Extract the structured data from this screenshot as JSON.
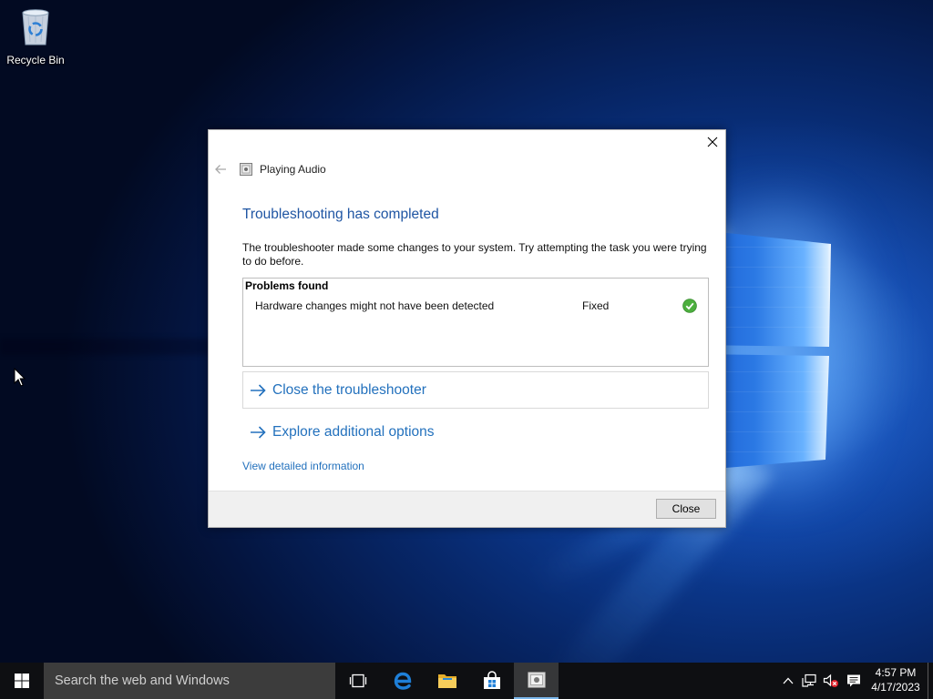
{
  "desktop": {
    "recycle_bin": {
      "label": "Recycle Bin",
      "icon": "recycle-bin-icon"
    },
    "cursor_icon": "mouse-pointer-icon"
  },
  "dialog": {
    "window_title": "Playing Audio",
    "title_icon": "troubleshooter-icon",
    "back_icon": "back-arrow-icon",
    "close_icon": "close-icon",
    "heading": "Troubleshooting has completed",
    "description": "The troubleshooter made some changes to your system. Try attempting the task you were trying to do before.",
    "problems": {
      "header": "Problems found",
      "items": [
        {
          "description": "Hardware changes might not have been detected",
          "status": "Fixed",
          "status_icon": "check-circle-icon"
        }
      ]
    },
    "actions": [
      {
        "label": "Close the troubleshooter",
        "icon": "arrow-right-icon"
      },
      {
        "label": "Explore additional options",
        "icon": "arrow-right-icon"
      }
    ],
    "details_link": "View detailed information",
    "close_button": "Close"
  },
  "taskbar": {
    "start_icon": "windows-logo-icon",
    "search": {
      "placeholder": "Search the web and Windows"
    },
    "apps": [
      {
        "icon": "task-view-icon",
        "active": false
      },
      {
        "icon": "edge-icon",
        "active": false
      },
      {
        "icon": "file-explorer-icon",
        "active": false
      },
      {
        "icon": "store-icon",
        "active": false
      },
      {
        "icon": "troubleshooter-icon",
        "active": true
      }
    ],
    "tray": {
      "icons": [
        "chevron-up-icon",
        "network-icon",
        "volume-muted-icon",
        "action-center-icon"
      ],
      "time": "4:57 PM",
      "date": "4/17/2023"
    }
  },
  "colors": {
    "accent": "#2371bd",
    "heading": "#1f55a3",
    "success": "#4caf3e",
    "taskbar": "#0e0f12",
    "active_indicator": "#7cb8ec",
    "desktop_dark": "#020a22",
    "desktop_glow": "#1d63d2"
  }
}
